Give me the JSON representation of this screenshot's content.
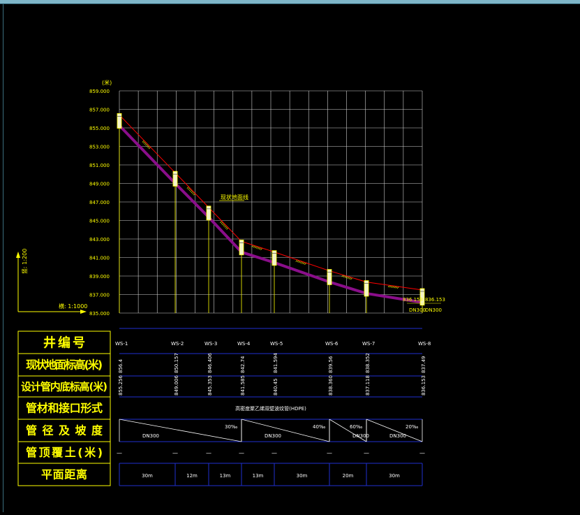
{
  "units_label": "(米)",
  "scale": {
    "vertical": "竖: 1:200",
    "horizontal": "横: 1:1000"
  },
  "y_axis_ticks": [
    "859.000",
    "857.000",
    "855.000",
    "853.000",
    "851.000",
    "849.000",
    "847.000",
    "845.000",
    "843.000",
    "841.000",
    "839.000",
    "837.000",
    "835.000"
  ],
  "ground_line_label": "现状地面线",
  "end_labels": {
    "left_value": "836.153",
    "right_value": "836.153",
    "left_dn": "DN300",
    "right_dn": "DN300"
  },
  "row_headers": [
    "井编号",
    "现状地面标高(米)",
    "设计管内底标高(米)",
    "管材和接口形式",
    "管径及坡度",
    "管顶覆土(米)",
    "平面距离"
  ],
  "wells": [
    {
      "id": "WS-1",
      "ground": "856.4",
      "invert": "855.256"
    },
    {
      "id": "WS-2",
      "ground": "850.157",
      "invert": "849.006"
    },
    {
      "id": "WS-3",
      "ground": "846.406",
      "invert": "845.353"
    },
    {
      "id": "WS-4",
      "ground": "842.74",
      "invert": "841.585"
    },
    {
      "id": "WS-5",
      "ground": "841.594",
      "invert": "840.45"
    },
    {
      "id": "WS-6",
      "ground": "839.56",
      "invert": "838.360"
    },
    {
      "id": "WS-7",
      "ground": "838.352",
      "invert": "837.118"
    },
    {
      "id": "WS-8",
      "ground": "837.49",
      "invert": "836.153"
    }
  ],
  "pipe_material": "高密度聚乙烯双壁波纹管(HDPE)",
  "pipe_segments": [
    {
      "dn": "DN300",
      "slope": "30‰"
    },
    {
      "dn": "DN300",
      "slope": "40‰"
    },
    {
      "dn": "DN300",
      "slope": "60‰"
    },
    {
      "dn": "DN300",
      "slope": "20‰"
    }
  ],
  "cover_marks": [
    "—",
    "—",
    "—",
    "—",
    "—",
    "—",
    "—",
    "—"
  ],
  "distances": [
    "30m",
    "12m",
    "13m",
    "13m",
    "30m",
    "20m",
    "30m"
  ],
  "colors": {
    "header_text": "#ffff00",
    "grid": "#d8d8d8",
    "pipe": "#8a0e8a",
    "ground": "#ff0000",
    "table_line": "#1f2fd0",
    "frame": "#7fb6c8"
  }
}
